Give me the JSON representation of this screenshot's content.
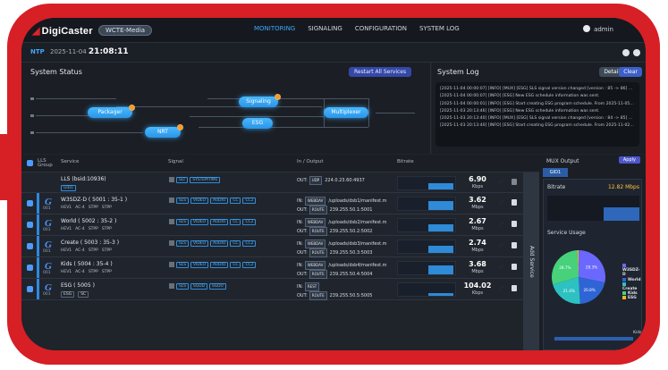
{
  "app": {
    "brand": "DigiCaster",
    "instance": "WCTE-Media",
    "nav": [
      "MONITORING",
      "SIGNALING",
      "CONFIGURATION",
      "SYSTEM LOG"
    ],
    "active_nav": "MONITORING",
    "user": "admin"
  },
  "status": {
    "ntp_tag": "NTP",
    "date": "2025-11-04",
    "time": "21:08:11"
  },
  "system_status": {
    "title": "System Status",
    "restart_label": "Restart All Services",
    "nodes": [
      "Packager",
      "Signaling",
      "ESG",
      "Multiplexer",
      "NRT"
    ]
  },
  "system_log": {
    "title": "System Log",
    "detail_label": "Detail",
    "clear_label": "Clear",
    "lines": [
      "[2025-11-04 00:00:07] [INFO] [MUX] [ESG] SLS signal version changed [version : 85 -> 86] ...",
      "[2025-11-04 00:00:07] [INFO] [ESG] New ESG schedule information was sent.",
      "[2025-11-04 00:00:01] [INFO] [ESG] Start creating ESG program schedule. From 2025-11-05T ...",
      "[2025-11-03 20:13:46] [INFO] [ESG] New ESG schedule information was sent.",
      "[2025-11-03 20:13:40] [INFO] [MUX] [ESG] SLS signal version changed [version : 84 -> 85] ...",
      "[2025-11-03 20:13:40] [INFO] [ESG] Start creating ESG program schedule. From 2025-11-02T ..."
    ]
  },
  "table": {
    "headers": {
      "group": "LLS Group",
      "service": "Service",
      "signal": "Signal",
      "io": "In / Output",
      "bitrate": "Bitrate"
    },
    "rows": [
      {
        "group": "",
        "service": "LLS (bsid:10936)",
        "sub": [
          "GID1"
        ],
        "signal_tags": [
          "SLT",
          "SYSTEMTIME"
        ],
        "in": "",
        "out_tag": "UDP",
        "out": "224.0.23.60:4937",
        "bitrate": "6.90",
        "unit": "Kbps",
        "level": 0.5
      },
      {
        "group": "001",
        "service": "W3SDZ-D ( 5001 : 35-1 )",
        "sub": [
          "HEV1",
          "AC-4",
          "STPP",
          "STPP"
        ],
        "signal_tags": [
          "SLS",
          "VIDEO",
          "AUDIO",
          "CC",
          "CC2"
        ],
        "in_tag": "WEBDAV",
        "in": "/uploads/dsb1/manifest.m",
        "out_tag": "ROUTE",
        "out": "239.255.50.1:5001",
        "bitrate": "3.62",
        "unit": "Mbps",
        "level": 0.72
      },
      {
        "group": "001",
        "service": "World ( 5002 : 35-2 )",
        "sub": [
          "HEV1",
          "AC-4",
          "STPP",
          "STPP"
        ],
        "signal_tags": [
          "SLS",
          "VIDEO",
          "AUDIO",
          "CC",
          "CC2"
        ],
        "in_tag": "WEBDAV",
        "in": "/uploads/dsb2/manifest.m",
        "out_tag": "ROUTE",
        "out": "239.255.50.2:5002",
        "bitrate": "2.67",
        "unit": "Mbps",
        "level": 0.54
      },
      {
        "group": "001",
        "service": "Create ( 5003 : 35-3 )",
        "sub": [
          "HEV1",
          "AC-4",
          "STPP",
          "STPP"
        ],
        "signal_tags": [
          "SLS",
          "VIDEO",
          "AUDIO",
          "CC",
          "CC2"
        ],
        "in_tag": "WEBDAV",
        "in": "/uploads/dsb3/manifest.m",
        "out_tag": "ROUTE",
        "out": "239.255.50.3:5003",
        "bitrate": "2.74",
        "unit": "Mbps",
        "level": 0.56
      },
      {
        "group": "001",
        "service": "Kids ( 5004 : 35-4 )",
        "sub": [
          "HEV1",
          "AC-4",
          "STPP",
          "STPP"
        ],
        "signal_tags": [
          "SLS",
          "VIDEO",
          "AUDIO",
          "CC",
          "CC2"
        ],
        "in_tag": "WEBDAV",
        "in": "/uploads/dsb4/manifest.m",
        "out_tag": "ROUTE",
        "out": "239.255.50.4:5004",
        "bitrate": "3.68",
        "unit": "Mbps",
        "level": 0.74
      },
      {
        "group": "001",
        "service": "ESG ( 5005 )",
        "sub": [
          "ESG",
          "SC"
        ],
        "signal_tags": [
          "SLS",
          "SGDD",
          "SGDU"
        ],
        "in_tag": "REST",
        "in": "",
        "out_tag": "ROUTE",
        "out": "239.255.50.5:5005",
        "bitrate": "104.02",
        "unit": "Kbps",
        "level": 0.18
      }
    ]
  },
  "side_panel": {
    "title": "MUX Output",
    "apply_label": "Apply",
    "tab": "GID1",
    "bitrate_label": "Bitrate",
    "bitrate_value": "12.82 Mbps",
    "usage_title": "Service Usage",
    "add_service": "Add Service",
    "legend": [
      "W3SDZ-D",
      "World",
      "Create",
      "Kids",
      "ESG"
    ],
    "pie_values": [
      28.3,
      20.8,
      21.4,
      28.7,
      0.8
    ],
    "pie_colors": [
      "#6b68ff",
      "#2f64d5",
      "#2dc1c1",
      "#46d17a",
      "#f0b429"
    ],
    "kids_label": "Kids"
  }
}
